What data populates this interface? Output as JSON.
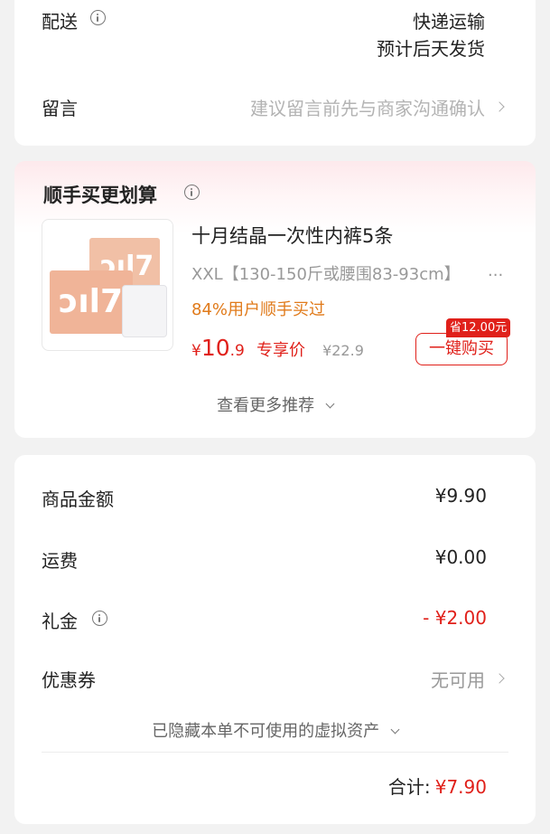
{
  "delivery": {
    "label": "配送",
    "method": "快递运输",
    "eta": "预计后天发货"
  },
  "message": {
    "label": "留言",
    "placeholder": "建议留言前先与商家沟通确认"
  },
  "addon": {
    "title": "顺手买更划算",
    "product": {
      "name": "十月结晶一次性内裤5条",
      "spec": "XXL【130-150斤或腰围83-93cm】",
      "spec_ellipsis": "...",
      "social_proof": "84%用户顺手买过",
      "currency": "¥",
      "price_int": "10",
      "price_dec": ".9",
      "price_tag": "专享价",
      "original_price": "¥22.9",
      "save_badge": "省12.00元",
      "buy_label": "一键购买"
    },
    "more_label": "查看更多推荐"
  },
  "summary": {
    "goods_label": "商品金额",
    "goods_value": "¥9.90",
    "shipping_label": "运费",
    "shipping_value": "¥0.00",
    "gift_label": "礼金",
    "gift_value": "- ¥2.00",
    "coupon_label": "优惠券",
    "coupon_value": "无可用",
    "hidden_assets": "已隐藏本单不可使用的虚拟资产",
    "total_label": "合计:",
    "total_value": "¥7.90"
  },
  "colors": {
    "accent": "#e0201a",
    "social_proof": "#e07a1a",
    "background": "#f2f2f2"
  }
}
